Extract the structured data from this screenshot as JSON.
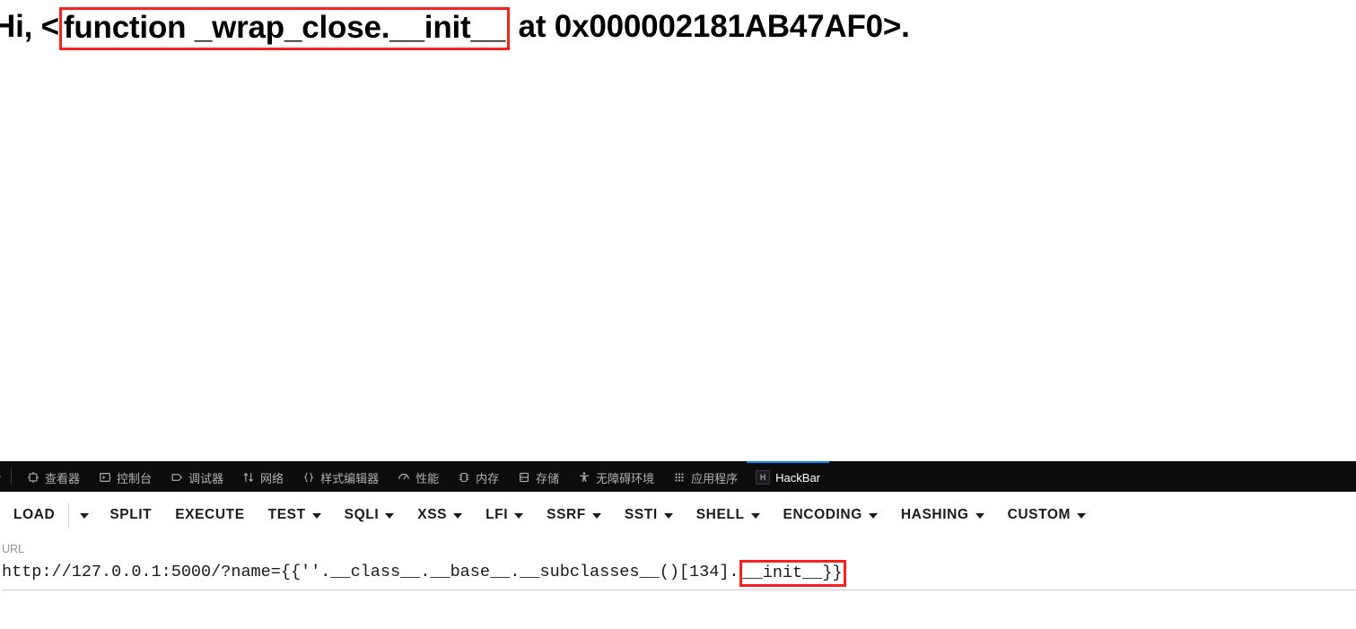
{
  "page": {
    "greeting_prefix": "Hi, <",
    "greeting_highlight": "function _wrap_close.__init__",
    "greeting_suffix": " at 0x000002181AB47AF0>.",
    "highlight_color": "#f62121"
  },
  "devtools": {
    "picker_icon": "element-picker-icon",
    "tabs": [
      {
        "label": "查看器",
        "icon": "inspector-icon",
        "active": false
      },
      {
        "label": "控制台",
        "icon": "console-icon",
        "active": false
      },
      {
        "label": "调试器",
        "icon": "debugger-icon",
        "active": false
      },
      {
        "label": "网络",
        "icon": "network-icon",
        "active": false
      },
      {
        "label": "样式编辑器",
        "icon": "style-editor-icon",
        "active": false
      },
      {
        "label": "性能",
        "icon": "performance-icon",
        "active": false
      },
      {
        "label": "内存",
        "icon": "memory-icon",
        "active": false
      },
      {
        "label": "存储",
        "icon": "storage-icon",
        "active": false
      },
      {
        "label": "无障碍环境",
        "icon": "accessibility-icon",
        "active": false
      },
      {
        "label": "应用程序",
        "icon": "application-icon",
        "active": false
      },
      {
        "label": "HackBar",
        "icon": "hackbar-icon",
        "active": true
      }
    ],
    "active_tab": "HackBar",
    "accent_color": "#0a84ff",
    "background_color": "#0c0c0d",
    "tab_text_color": "#b1b1b3"
  },
  "hackbar": {
    "buttons": [
      {
        "label": "LOAD",
        "caret": false,
        "name": "load-button"
      },
      {
        "label": "",
        "caret": true,
        "name": "load-dropdown-button"
      },
      {
        "label": "SPLIT",
        "caret": false,
        "name": "split-button"
      },
      {
        "label": "EXECUTE",
        "caret": false,
        "name": "execute-button"
      },
      {
        "label": "TEST",
        "caret": true,
        "name": "test-button"
      },
      {
        "label": "SQLI",
        "caret": true,
        "name": "sqli-button"
      },
      {
        "label": "XSS",
        "caret": true,
        "name": "xss-button"
      },
      {
        "label": "LFI",
        "caret": true,
        "name": "lfi-button"
      },
      {
        "label": "SSRF",
        "caret": true,
        "name": "ssrf-button"
      },
      {
        "label": "SSTI",
        "caret": true,
        "name": "ssti-button"
      },
      {
        "label": "SHELL",
        "caret": true,
        "name": "shell-button"
      },
      {
        "label": "ENCODING",
        "caret": true,
        "name": "encoding-button"
      },
      {
        "label": "HASHING",
        "caret": true,
        "name": "hashing-button"
      },
      {
        "label": "CUSTOM",
        "caret": true,
        "name": "custom-button"
      }
    ],
    "url_field": {
      "label": "URL",
      "value_prefix": "http://127.0.0.1:5000/?name={{''.__class__.__base__.__subclasses__()[134].",
      "value_highlight": "__init__}}",
      "full_value": "http://127.0.0.1:5000/?name={{''.__class__.__base__.__subclasses__()[134].__init__}}"
    }
  }
}
